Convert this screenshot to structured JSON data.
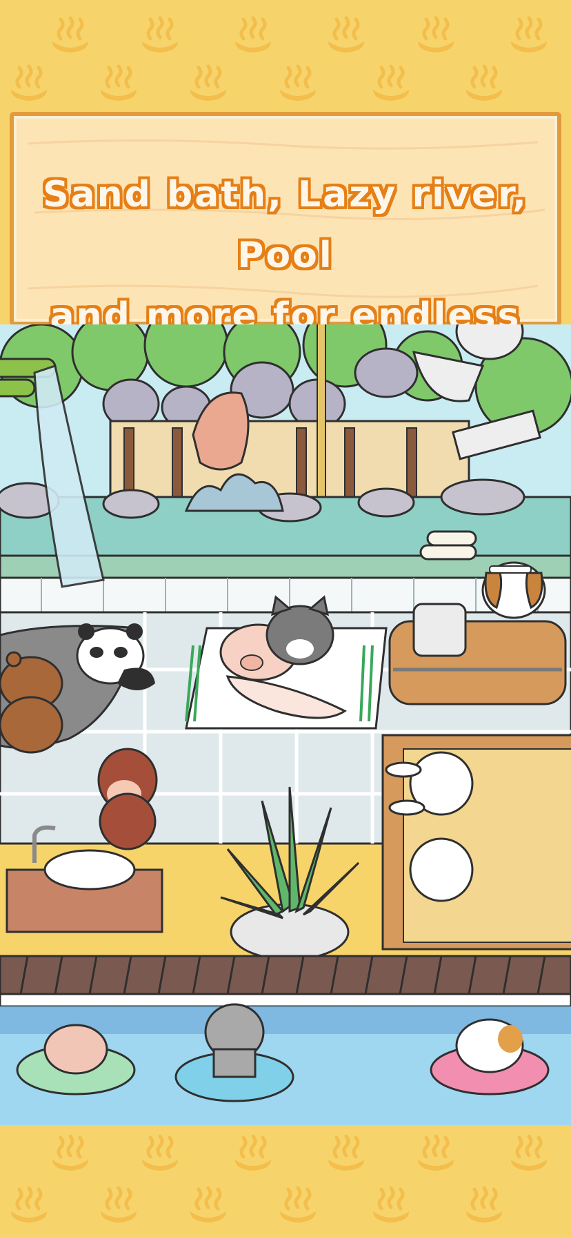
{
  "banner": {
    "line1": "Sand bath, Lazy river, Pool",
    "line2": "and more for endless fun !"
  },
  "colors": {
    "background_yellow": "#f6d46b",
    "onsen_icon": "#f3be4c",
    "banner_fill": "#fde4b4",
    "banner_border": "#e39a3a",
    "banner_text_outline": "#e57f16",
    "pool_water": "#9fd6f0",
    "floor_tile": "#dfe9ec"
  },
  "scene": {
    "areas": [
      "garden",
      "waterfall",
      "bathtub",
      "mat",
      "barrel-bath",
      "sand-bath",
      "sink",
      "plant",
      "pool"
    ],
    "characters": [
      "cat-statue",
      "tiger-cat",
      "pig",
      "dog",
      "panda",
      "bear",
      "monkey",
      "rabbit",
      "white-cat",
      "pig-on-float",
      "gray-cat",
      "calico-cat"
    ]
  }
}
